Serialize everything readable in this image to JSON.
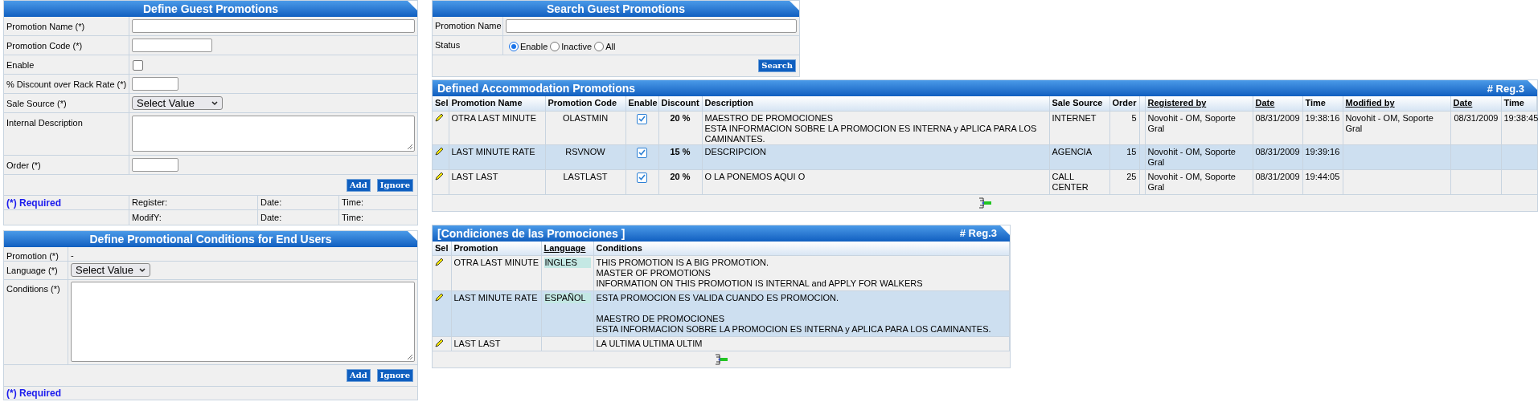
{
  "guest_form": {
    "title": "Define Guest Promotions",
    "fields": [
      {
        "kind": "wide",
        "label": "Promotion Name (*)"
      },
      {
        "kind": "medium",
        "label": "Promotion Code (*)"
      },
      {
        "kind": "checkbox",
        "label": "Enable",
        "checked": false
      },
      {
        "kind": "short",
        "label": "% Discount over Rack Rate (*)"
      },
      {
        "kind": "select",
        "label": "Sale Source (*)",
        "value": "Select Value"
      },
      {
        "kind": "textarea",
        "label": "Internal Description"
      },
      {
        "kind": "short",
        "label": "Order (*)"
      }
    ],
    "buttons": [
      "Add",
      "Ignore"
    ],
    "footer": {
      "required": "(*) Required",
      "register": "Register:",
      "register_date": "Date:",
      "register_time": "Time:",
      "modify": "ModifY:",
      "modify_date": "Date:",
      "modify_time": "Time:"
    }
  },
  "conditions_form": {
    "title": "Define Promotional Conditions for End Users",
    "promotion_label": "Promotion (*)",
    "promotion_value": "-",
    "language_label": "Language (*)",
    "language_value": "Select Value",
    "conditions_label": "Conditions (*)",
    "buttons": [
      "Add",
      "Ignore"
    ],
    "required": "(*) Required"
  },
  "search": {
    "title": "Search Guest Promotions",
    "name_label": "Promotion Name",
    "status_label": "Status",
    "radios": [
      {
        "label": "Enable",
        "selected": true
      },
      {
        "label": "Inactive",
        "selected": false
      },
      {
        "label": "All",
        "selected": false
      }
    ],
    "button": "Search"
  },
  "accommodation": {
    "title": "Defined Accommodation Promotions",
    "count": "# Reg.3",
    "columns": [
      {
        "label": "Sel",
        "sortable": false
      },
      {
        "label": "Promotion Name",
        "sortable": false
      },
      {
        "label": "Promotion Code",
        "sortable": false
      },
      {
        "label": "Enable",
        "sortable": false
      },
      {
        "label": "Discount",
        "sortable": false
      },
      {
        "label": "Description",
        "sortable": false
      },
      {
        "label": "Sale Source",
        "sortable": false
      },
      {
        "label": "Order",
        "sortable": false
      },
      {
        "label": "Registered by",
        "sortable": true
      },
      {
        "label": "Date",
        "sortable": true
      },
      {
        "label": "Time",
        "sortable": false
      },
      {
        "label": "Modified by",
        "sortable": true
      },
      {
        "label": "Date",
        "sortable": true
      },
      {
        "label": "Time",
        "sortable": false
      }
    ],
    "rows": [
      {
        "selected": false,
        "name": "OTRA LAST MINUTE",
        "code": "OLASTMIN",
        "enabled": true,
        "discount": "20  %",
        "description": "MAESTRO DE PROMOCIONES\nESTA INFORMACION SOBRE LA PROMOCION ES INTERNA y APLICA PARA LOS CAMINANTES.",
        "sale_source": "INTERNET",
        "order": "5",
        "registered_by": "Novohit - OM, Soporte Gral",
        "date": "08/31/2009",
        "time": "19:38:16",
        "modified_by": "Novohit - OM, Soporte Gral",
        "modified_date": "08/31/2009",
        "modified_time": "19:38:45"
      },
      {
        "selected": true,
        "name": "LAST MINUTE RATE",
        "code": "RSVNOW",
        "enabled": true,
        "discount": "15  %",
        "description": "DESCRIPCION",
        "sale_source": "AGENCIA",
        "order": "15",
        "registered_by": "Novohit - OM, Soporte Gral",
        "date": "08/31/2009",
        "time": "19:39:16"
      },
      {
        "selected": false,
        "name": "LAST LAST",
        "code": "LASTLAST",
        "enabled": true,
        "discount": "20  %",
        "description": "O LA PONEMOS AQUI O",
        "sale_source": "CALL CENTER",
        "order": "25",
        "registered_by": "Novohit - OM, Soporte Gral",
        "date": "08/31/2009",
        "time": "19:44:05"
      }
    ]
  },
  "conditions": {
    "title": "[Condiciones de las Promociones ]",
    "count": "# Reg.3",
    "columns": [
      {
        "label": "Sel",
        "sortable": false
      },
      {
        "label": "Promotion",
        "sortable": false
      },
      {
        "label": "Language",
        "sortable": true
      },
      {
        "label": "Conditions",
        "sortable": false
      }
    ],
    "rows": [
      {
        "selected": false,
        "promotion": "OTRA LAST MINUTE",
        "language": "INGLES",
        "conditions": "THIS PROMOTION IS A BIG PROMOTION.\nMASTER OF PROMOTIONS\nINFORMATION ON THIS PROMOTION IS INTERNAL and APPLY FOR WALKERS"
      },
      {
        "selected": true,
        "promotion": "LAST MINUTE RATE",
        "language": "ESPAÑOL",
        "conditions": "ESTA PROMOCION ES VALIDA CUANDO ES PROMOCION.\n\nMAESTRO DE PROMOCIONES\nESTA INFORMACION SOBRE LA PROMOCION ES INTERNA y APLICA PARA LOS CAMINANTES."
      },
      {
        "selected": false,
        "promotion": "LAST LAST",
        "conditions": "LA ULTIMA ULTIMA ULTIM"
      }
    ]
  }
}
